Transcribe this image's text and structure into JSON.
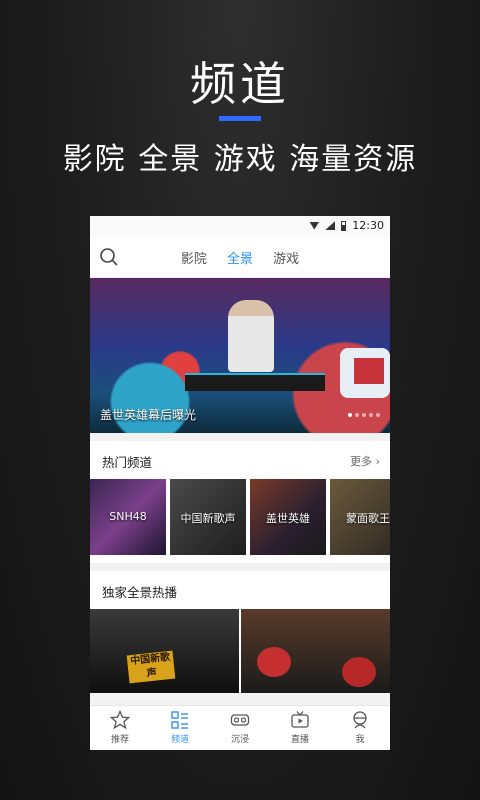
{
  "promo": {
    "title": "频道",
    "subtitle": "影院 全景 游戏 海量资源",
    "accent": "#2f6bff"
  },
  "status_bar": {
    "time": "12:30",
    "icons": [
      "wifi-icon",
      "signal-icon",
      "battery-icon"
    ]
  },
  "top_nav": {
    "search_icon": "search-icon",
    "tabs": [
      {
        "label": "影院",
        "active": false
      },
      {
        "label": "全景",
        "active": true
      },
      {
        "label": "游戏",
        "active": false
      }
    ],
    "active_color": "#2f8ff5"
  },
  "banner": {
    "caption": "盖世英雄幕后曝光",
    "dots_count": 5,
    "active_dot": 0
  },
  "hot_channels": {
    "title": "热门频道",
    "more_label": "更多",
    "items": [
      {
        "label": "SNH48"
      },
      {
        "label": "中国新歌声"
      },
      {
        "label": "盖世英雄"
      },
      {
        "label": "蒙面歌王"
      }
    ]
  },
  "exclusive": {
    "title": "独家全景热播",
    "items": [
      {
        "logo_text": "中国新歌声"
      },
      {
        "logo_text": ""
      }
    ]
  },
  "bottom_nav": {
    "items": [
      {
        "label": "推荐",
        "icon": "star-icon",
        "active": false
      },
      {
        "label": "频道",
        "icon": "channel-list-icon",
        "active": true
      },
      {
        "label": "沉浸",
        "icon": "vr-glasses-icon",
        "active": false
      },
      {
        "label": "直播",
        "icon": "tv-icon",
        "active": false
      },
      {
        "label": "我",
        "icon": "user-icon",
        "active": false
      }
    ]
  }
}
